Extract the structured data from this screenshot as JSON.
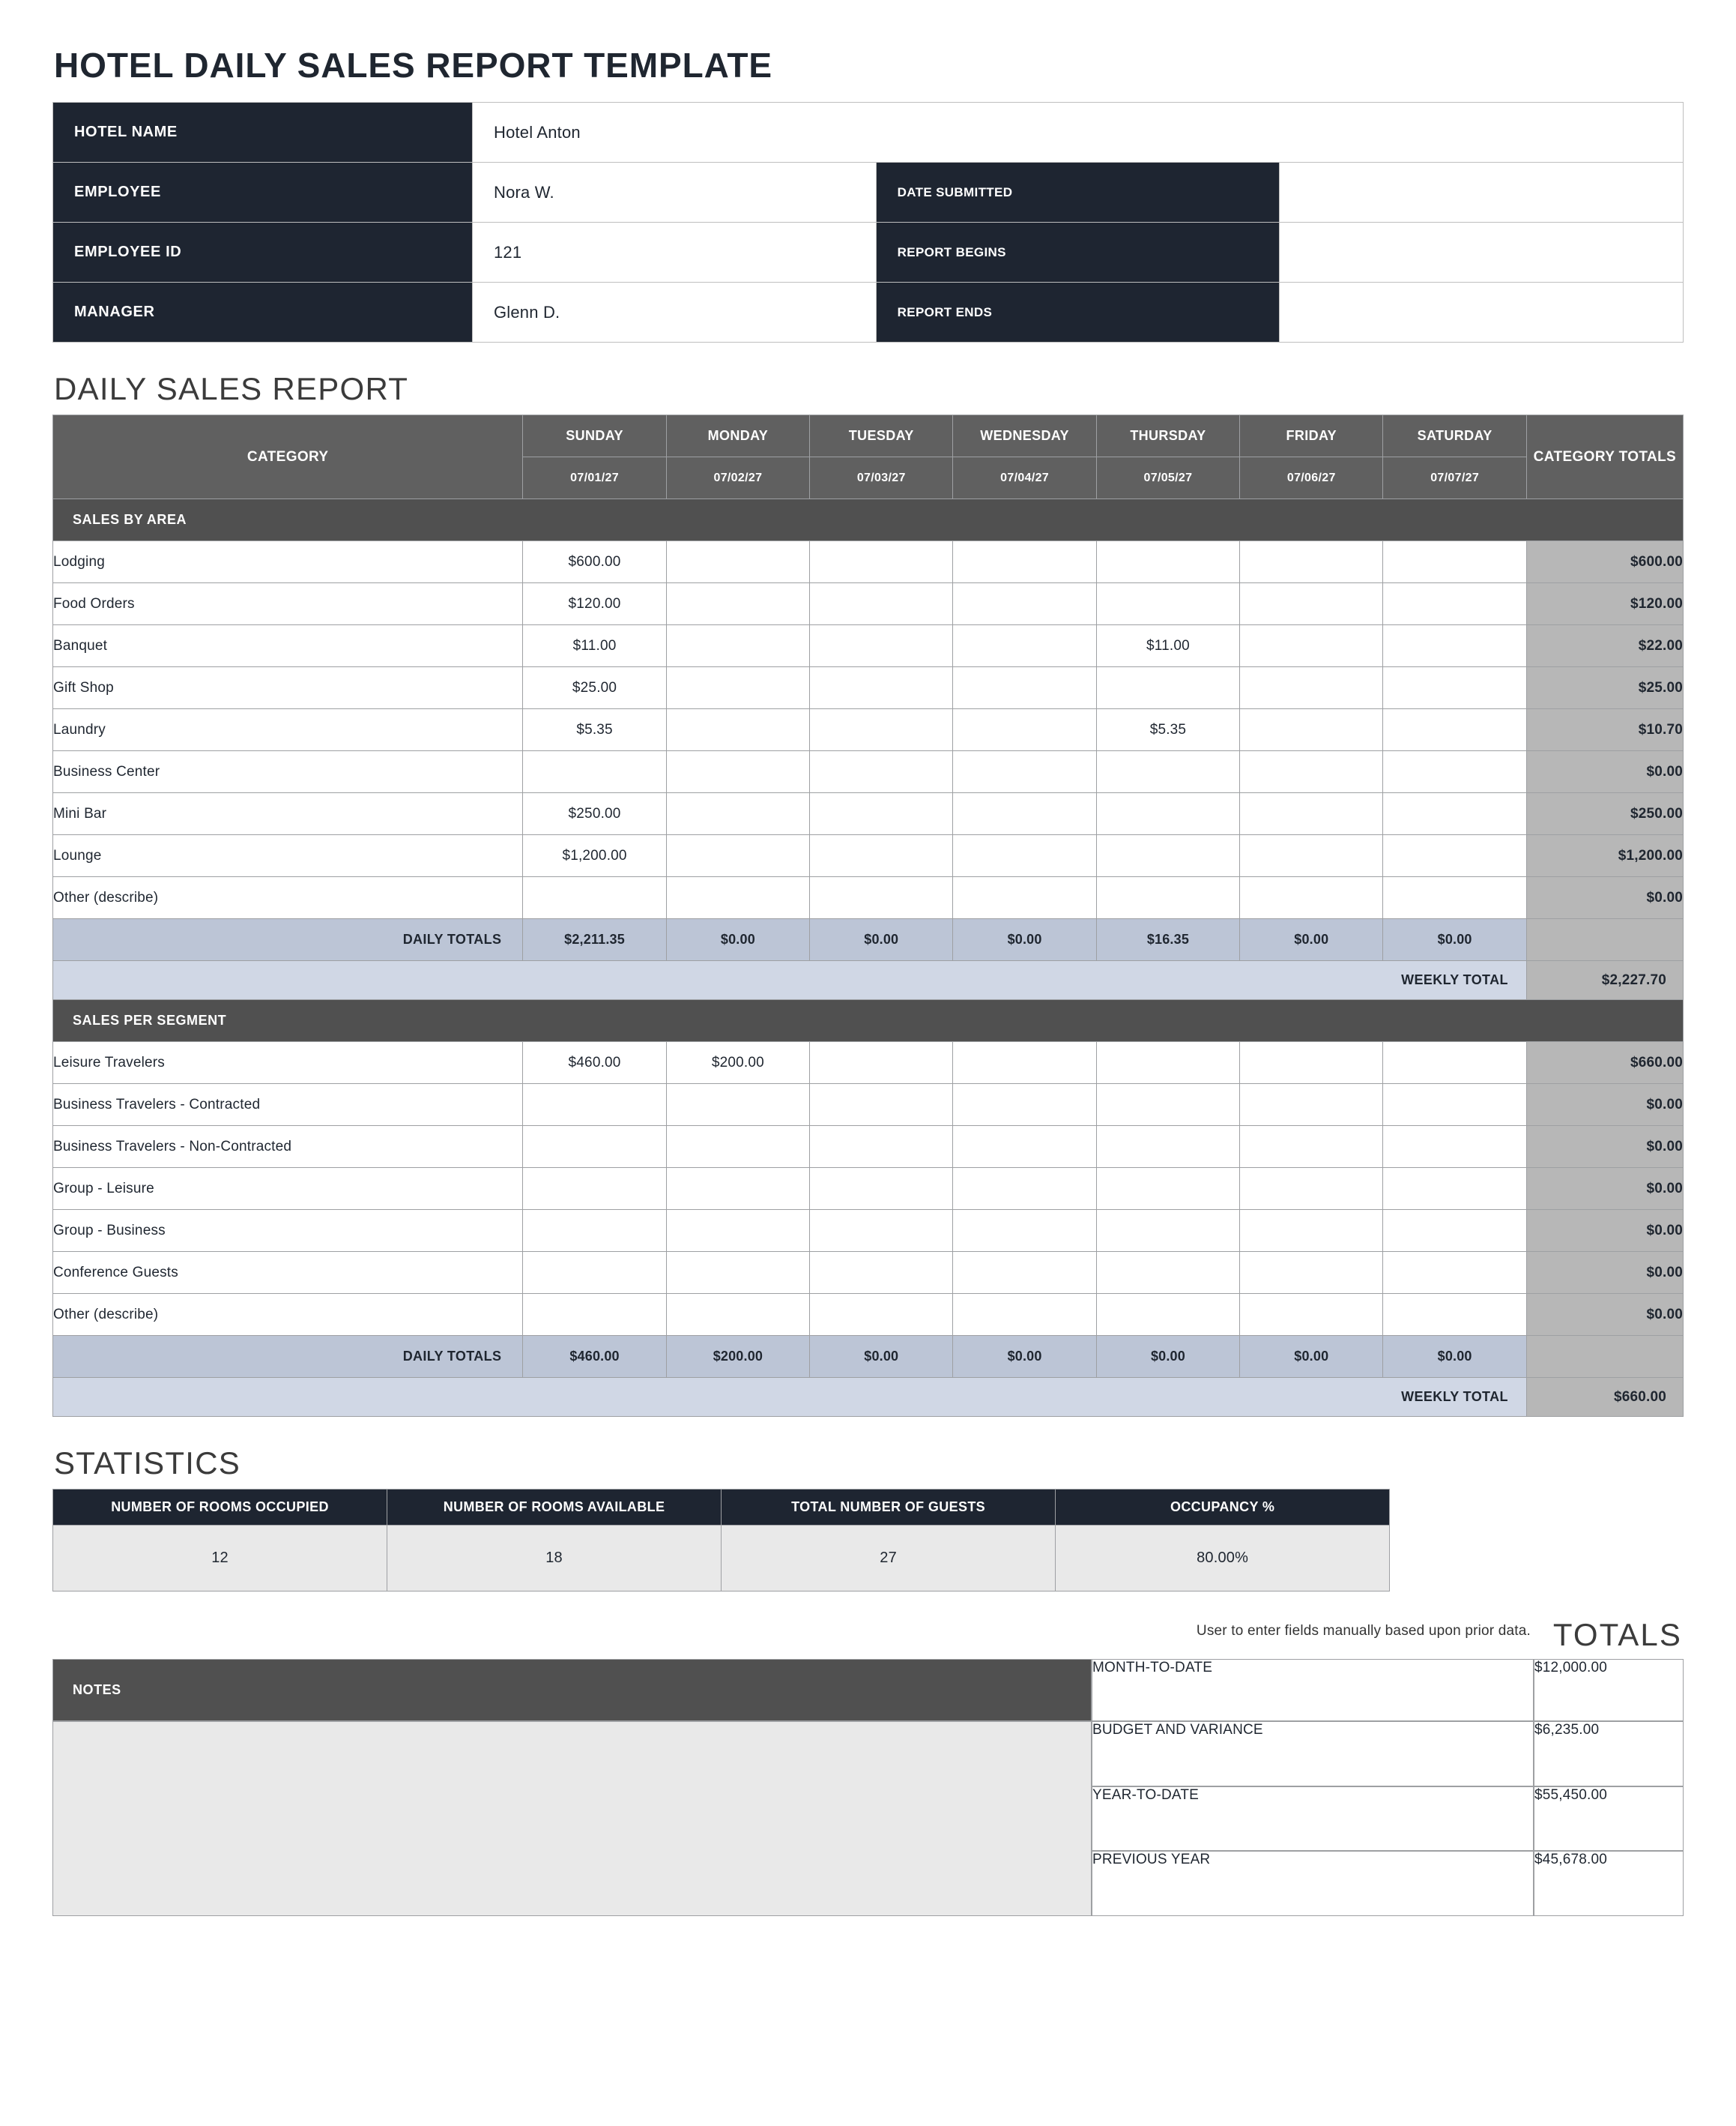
{
  "title": "HOTEL DAILY SALES REPORT TEMPLATE",
  "info": {
    "labels": {
      "hotel_name": "HOTEL NAME",
      "employee": "EMPLOYEE",
      "employee_id": "EMPLOYEE ID",
      "manager": "MANAGER",
      "date_submitted": "DATE SUBMITTED",
      "report_begins": "REPORT BEGINS",
      "report_ends": "REPORT ENDS"
    },
    "values": {
      "hotel_name": "Hotel Anton",
      "employee": "Nora W.",
      "employee_id": "121",
      "manager": "Glenn D.",
      "date_submitted": "",
      "report_begins": "",
      "report_ends": ""
    }
  },
  "sections": {
    "daily_sales": "DAILY SALES REPORT",
    "statistics": "STATISTICS",
    "totals": "TOTALS"
  },
  "report": {
    "header": {
      "category": "CATEGORY",
      "days": [
        "SUNDAY",
        "MONDAY",
        "TUESDAY",
        "WEDNESDAY",
        "THURSDAY",
        "FRIDAY",
        "SATURDAY"
      ],
      "dates": [
        "07/01/27",
        "07/02/27",
        "07/03/27",
        "07/04/27",
        "07/05/27",
        "07/06/27",
        "07/07/27"
      ],
      "category_totals": "CATEGORY TOTALS"
    },
    "labels": {
      "daily_totals": "DAILY TOTALS",
      "weekly_total": "WEEKLY TOTAL"
    },
    "groups": [
      {
        "title": "SALES BY AREA",
        "rows": [
          {
            "name": "Lodging",
            "cells": [
              "$600.00",
              "",
              "",
              "",
              "",
              "",
              ""
            ],
            "total": "$600.00"
          },
          {
            "name": "Food Orders",
            "cells": [
              "$120.00",
              "",
              "",
              "",
              "",
              "",
              ""
            ],
            "total": "$120.00"
          },
          {
            "name": "Banquet",
            "cells": [
              "$11.00",
              "",
              "",
              "",
              "$11.00",
              "",
              ""
            ],
            "total": "$22.00"
          },
          {
            "name": "Gift Shop",
            "cells": [
              "$25.00",
              "",
              "",
              "",
              "",
              "",
              ""
            ],
            "total": "$25.00"
          },
          {
            "name": "Laundry",
            "cells": [
              "$5.35",
              "",
              "",
              "",
              "$5.35",
              "",
              ""
            ],
            "total": "$10.70"
          },
          {
            "name": "Business Center",
            "cells": [
              "",
              "",
              "",
              "",
              "",
              "",
              ""
            ],
            "total": "$0.00"
          },
          {
            "name": "Mini Bar",
            "cells": [
              "$250.00",
              "",
              "",
              "",
              "",
              "",
              ""
            ],
            "total": "$250.00"
          },
          {
            "name": "Lounge",
            "cells": [
              "$1,200.00",
              "",
              "",
              "",
              "",
              "",
              ""
            ],
            "total": "$1,200.00"
          },
          {
            "name": "Other (describe)",
            "cells": [
              "",
              "",
              "",
              "",
              "",
              "",
              ""
            ],
            "total": "$0.00"
          }
        ],
        "daily_totals": [
          "$2,211.35",
          "$0.00",
          "$0.00",
          "$0.00",
          "$16.35",
          "$0.00",
          "$0.00"
        ],
        "weekly_total": "$2,227.70"
      },
      {
        "title": "SALES PER SEGMENT",
        "rows": [
          {
            "name": "Leisure Travelers",
            "cells": [
              "$460.00",
              "$200.00",
              "",
              "",
              "",
              "",
              ""
            ],
            "total": "$660.00"
          },
          {
            "name": "Business Travelers - Contracted",
            "cells": [
              "",
              "",
              "",
              "",
              "",
              "",
              ""
            ],
            "total": "$0.00"
          },
          {
            "name": "Business Travelers - Non-Contracted",
            "cells": [
              "",
              "",
              "",
              "",
              "",
              "",
              ""
            ],
            "total": "$0.00"
          },
          {
            "name": "Group - Leisure",
            "cells": [
              "",
              "",
              "",
              "",
              "",
              "",
              ""
            ],
            "total": "$0.00"
          },
          {
            "name": "Group - Business",
            "cells": [
              "",
              "",
              "",
              "",
              "",
              "",
              ""
            ],
            "total": "$0.00"
          },
          {
            "name": "Conference Guests",
            "cells": [
              "",
              "",
              "",
              "",
              "",
              "",
              ""
            ],
            "total": "$0.00"
          },
          {
            "name": "Other (describe)",
            "cells": [
              "",
              "",
              "",
              "",
              "",
              "",
              ""
            ],
            "total": "$0.00"
          }
        ],
        "daily_totals": [
          "$460.00",
          "$200.00",
          "$0.00",
          "$0.00",
          "$0.00",
          "$0.00",
          "$0.00"
        ],
        "weekly_total": "$660.00"
      }
    ]
  },
  "stats": {
    "headers": [
      "NUMBER OF ROOMS OCCUPIED",
      "NUMBER OF ROOMS AVAILABLE",
      "TOTAL NUMBER OF GUESTS",
      "OCCUPANCY %"
    ],
    "values": [
      "12",
      "18",
      "27",
      "80.00%"
    ]
  },
  "notes_hint": "User to enter fields manually based upon prior data.",
  "notes_label": "NOTES",
  "totals": [
    {
      "label": "MONTH-TO-DATE",
      "value": "$12,000.00"
    },
    {
      "label": "BUDGET AND VARIANCE",
      "value": "$6,235.00"
    },
    {
      "label": "YEAR-TO-DATE",
      "value": "$55,450.00"
    },
    {
      "label": "PREVIOUS YEAR",
      "value": "$45,678.00"
    }
  ]
}
